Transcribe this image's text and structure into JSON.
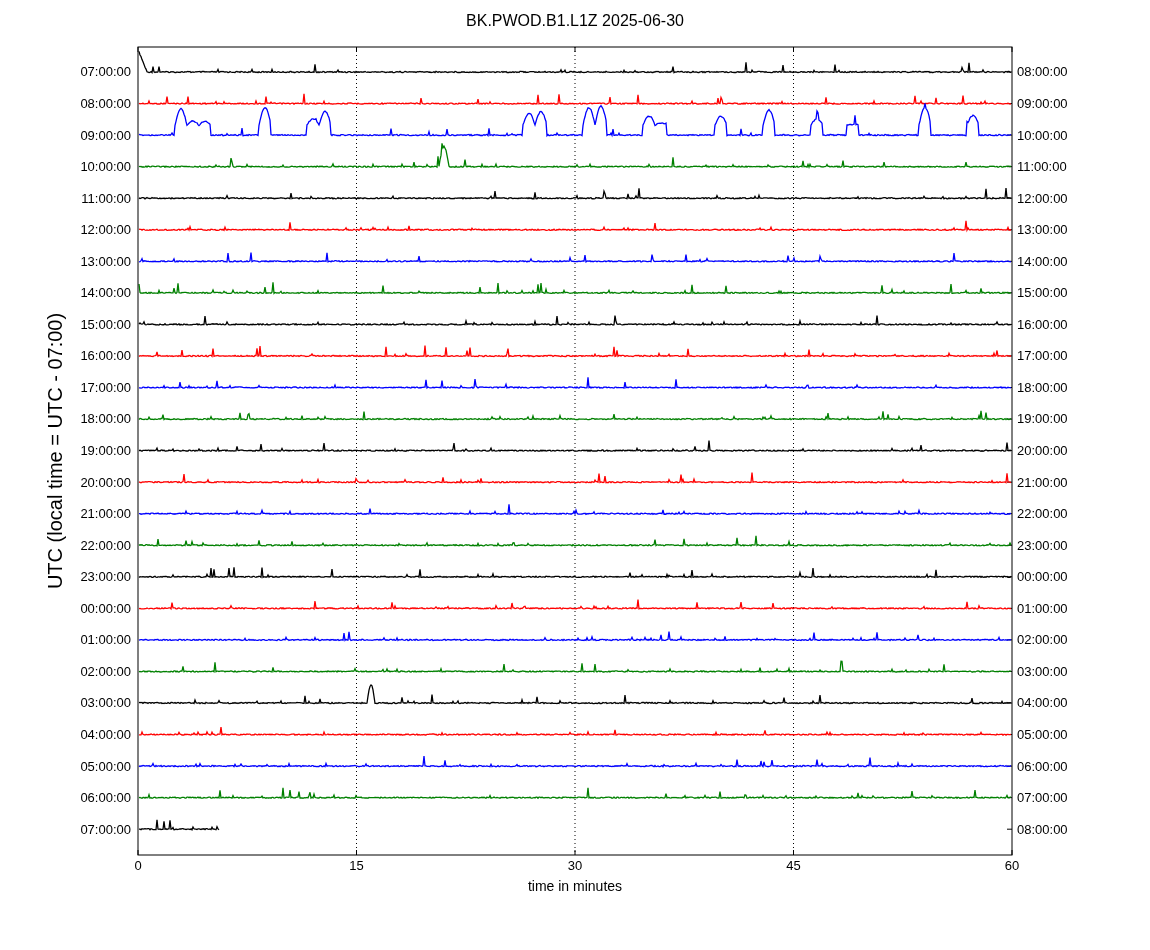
{
  "title": "BK.PWOD.B1.L1Z 2025-06-30",
  "ylabel": "UTC (local time = UTC - 07:00)",
  "xlabel": "time in minutes",
  "xticks": [
    "0",
    "15",
    "30",
    "45",
    "60"
  ],
  "rows": [
    {
      "left": "07:00:00",
      "right": "08:00:00",
      "color": "#000000",
      "level": 1
    },
    {
      "left": "08:00:00",
      "right": "09:00:00",
      "color": "#ff0000",
      "level": 1
    },
    {
      "left": "09:00:00",
      "right": "10:00:00",
      "color": "#0000ff",
      "level": 1
    },
    {
      "left": "10:00:00",
      "right": "11:00:00",
      "color": "#008000",
      "level": 1
    },
    {
      "left": "11:00:00",
      "right": "12:00:00",
      "color": "#000000",
      "level": 1
    },
    {
      "left": "12:00:00",
      "right": "13:00:00",
      "color": "#ff0000",
      "level": 1
    },
    {
      "left": "13:00:00",
      "right": "14:00:00",
      "color": "#0000ff",
      "level": 1
    },
    {
      "left": "14:00:00",
      "right": "15:00:00",
      "color": "#008000",
      "level": 1
    },
    {
      "left": "15:00:00",
      "right": "16:00:00",
      "color": "#000000",
      "level": 1
    },
    {
      "left": "16:00:00",
      "right": "17:00:00",
      "color": "#ff0000",
      "level": 1
    },
    {
      "left": "17:00:00",
      "right": "18:00:00",
      "color": "#0000ff",
      "level": 1
    },
    {
      "left": "18:00:00",
      "right": "19:00:00",
      "color": "#008000",
      "level": 1
    },
    {
      "left": "19:00:00",
      "right": "20:00:00",
      "color": "#000000",
      "level": 1
    },
    {
      "left": "20:00:00",
      "right": "21:00:00",
      "color": "#ff0000",
      "level": 1
    },
    {
      "left": "21:00:00",
      "right": "22:00:00",
      "color": "#0000ff",
      "level": 1
    },
    {
      "left": "22:00:00",
      "right": "23:00:00",
      "color": "#008000",
      "level": 1
    },
    {
      "left": "23:00:00",
      "right": "00:00:00",
      "color": "#000000",
      "level": 1
    },
    {
      "left": "00:00:00",
      "right": "01:00:00",
      "color": "#ff0000",
      "level": 1
    },
    {
      "left": "01:00:00",
      "right": "02:00:00",
      "color": "#0000ff",
      "level": 1
    },
    {
      "left": "02:00:00",
      "right": "03:00:00",
      "color": "#008000",
      "level": 1
    },
    {
      "left": "03:00:00",
      "right": "04:00:00",
      "color": "#000000",
      "level": 1
    },
    {
      "left": "04:00:00",
      "right": "05:00:00",
      "color": "#ff0000",
      "level": 1
    },
    {
      "left": "05:00:00",
      "right": "06:00:00",
      "color": "#0000ff",
      "level": 1
    },
    {
      "left": "06:00:00",
      "right": "07:00:00",
      "color": "#008000",
      "level": 1
    },
    {
      "left": "07:00:00",
      "right": "08:00:00",
      "color": "#000000",
      "level": 0.092
    }
  ]
}
